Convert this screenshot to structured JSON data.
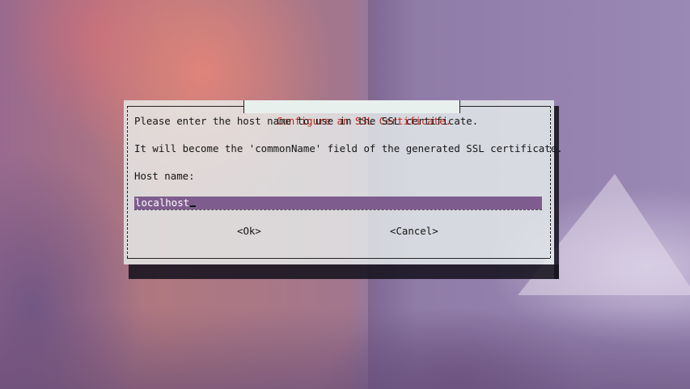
{
  "dialog": {
    "title": "Configure an SSL Certificate.",
    "line_prompt": "Please enter the host name to use in the SSL certificate.",
    "line_info": "It will become the 'commonName' field of the generated SSL certificate.",
    "field_label": "Host name:",
    "host_value": "localhost",
    "ok_label": "<Ok>",
    "cancel_label": "<Cancel>"
  },
  "colors": {
    "title_text": "#c0261c",
    "input_highlight": "#7e5d8e",
    "dialog_background": "#e8f0ee",
    "shadow": "#16121e"
  }
}
